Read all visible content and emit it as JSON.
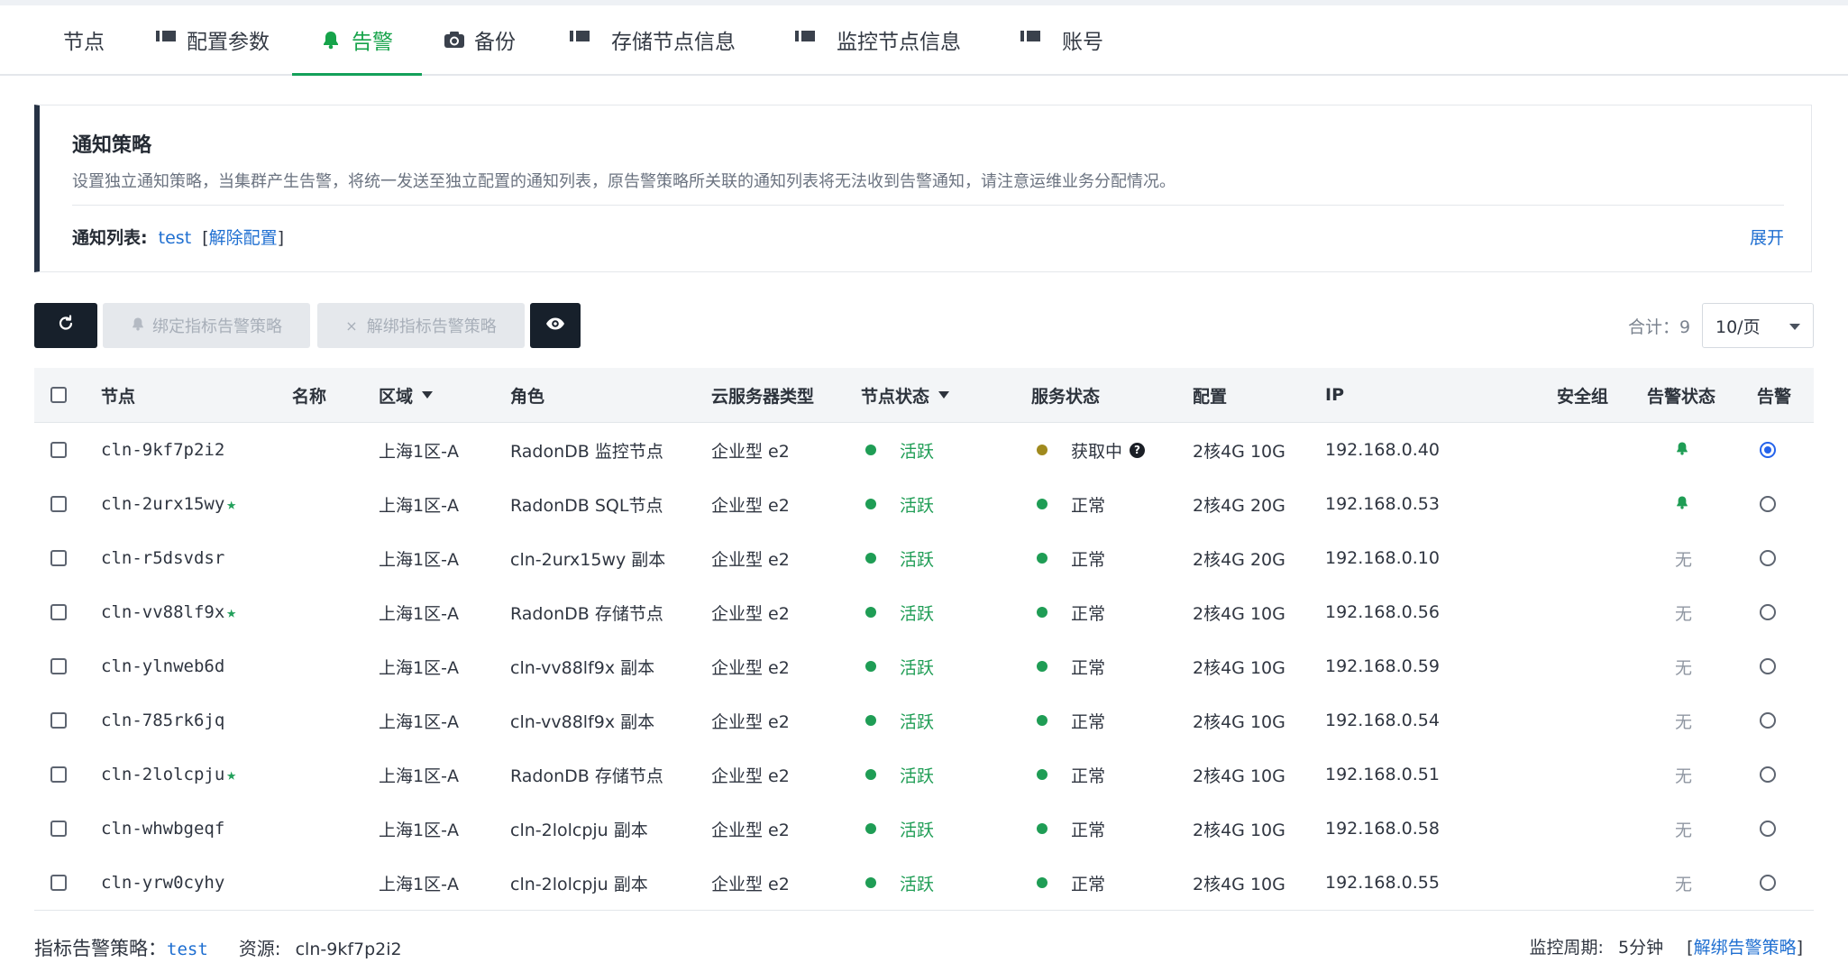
{
  "tabs": [
    {
      "label": "节点",
      "icon": "grid-icon"
    },
    {
      "label": "配置参数",
      "icon": "list-icon"
    },
    {
      "label": "告警",
      "icon": "bell-icon",
      "active": true
    },
    {
      "label": "备份",
      "icon": "camera-icon"
    },
    {
      "label": "存储节点信息",
      "icon": "list-icon"
    },
    {
      "label": "监控节点信息",
      "icon": "list-icon"
    },
    {
      "label": "账号",
      "icon": "list-icon"
    }
  ],
  "notice": {
    "title": "通知策略",
    "description": "设置独立通知策略，当集群产生告警，将统一发送至独立配置的通知列表，原告警策略所关联的通知列表将无法收到告警通知，请注意运维业务分配情况。",
    "list_label": "通知列表:",
    "list_value": "test",
    "unbind_open": "[",
    "unbind_link": "解除配置",
    "unbind_close": "]",
    "expand": "展开"
  },
  "toolbar": {
    "refresh_icon": "refresh-icon",
    "bind_label": "绑定指标告警策略",
    "unbind_label": "解绑指标告警策略",
    "eye_icon": "eye-icon",
    "total": "合计：9",
    "page_size": "10/页"
  },
  "table": {
    "headers": {
      "node": "节点",
      "name": "名称",
      "zone": "区域",
      "role": "角色",
      "server_type": "云服务器类型",
      "node_status": "节点状态",
      "service_status": "服务状态",
      "config": "配置",
      "ip": "IP",
      "security_group": "安全组",
      "alarm_status": "告警状态",
      "alarm": "告警"
    },
    "rows": [
      {
        "node": "cln-9kf7p2i2",
        "star": "",
        "zone": "上海1区-A",
        "role": "RadonDB 监控节点",
        "server_type": "企业型 e2",
        "node_status": "活跃",
        "service_status": "获取中",
        "service_color": "#a08a1e",
        "service_help": "?",
        "config": "2核4G 10G",
        "ip": "192.168.0.40",
        "alarm_status": "bell",
        "alarm_status_text": "",
        "selected": true
      },
      {
        "node": "cln-2urx15wy",
        "star": "★",
        "zone": "上海1区-A",
        "role": "RadonDB SQL节点",
        "server_type": "企业型 e2",
        "node_status": "活跃",
        "service_status": "正常",
        "service_color": "#1f9d55",
        "service_help": "",
        "config": "2核4G 20G",
        "ip": "192.168.0.53",
        "alarm_status": "bell",
        "alarm_status_text": "",
        "selected": false
      },
      {
        "node": "cln-r5dsvdsr",
        "star": "",
        "zone": "上海1区-A",
        "role": "cln-2urx15wy 副本",
        "server_type": "企业型 e2",
        "node_status": "活跃",
        "service_status": "正常",
        "service_color": "#1f9d55",
        "service_help": "",
        "config": "2核4G 20G",
        "ip": "192.168.0.10",
        "alarm_status": "text",
        "alarm_status_text": "无",
        "selected": false
      },
      {
        "node": "cln-vv88lf9x",
        "star": "★",
        "zone": "上海1区-A",
        "role": "RadonDB 存储节点",
        "server_type": "企业型 e2",
        "node_status": "活跃",
        "service_status": "正常",
        "service_color": "#1f9d55",
        "service_help": "",
        "config": "2核4G 10G",
        "ip": "192.168.0.56",
        "alarm_status": "text",
        "alarm_status_text": "无",
        "selected": false
      },
      {
        "node": "cln-ylnweb6d",
        "star": "",
        "zone": "上海1区-A",
        "role": "cln-vv88lf9x 副本",
        "server_type": "企业型 e2",
        "node_status": "活跃",
        "service_status": "正常",
        "service_color": "#1f9d55",
        "service_help": "",
        "config": "2核4G 10G",
        "ip": "192.168.0.59",
        "alarm_status": "text",
        "alarm_status_text": "无",
        "selected": false
      },
      {
        "node": "cln-785rk6jq",
        "star": "",
        "zone": "上海1区-A",
        "role": "cln-vv88lf9x 副本",
        "server_type": "企业型 e2",
        "node_status": "活跃",
        "service_status": "正常",
        "service_color": "#1f9d55",
        "service_help": "",
        "config": "2核4G 10G",
        "ip": "192.168.0.54",
        "alarm_status": "text",
        "alarm_status_text": "无",
        "selected": false
      },
      {
        "node": "cln-2lolcpju",
        "star": "★",
        "zone": "上海1区-A",
        "role": "RadonDB 存储节点",
        "server_type": "企业型 e2",
        "node_status": "活跃",
        "service_status": "正常",
        "service_color": "#1f9d55",
        "service_help": "",
        "config": "2核4G 10G",
        "ip": "192.168.0.51",
        "alarm_status": "text",
        "alarm_status_text": "无",
        "selected": false
      },
      {
        "node": "cln-whwbgeqf",
        "star": "",
        "zone": "上海1区-A",
        "role": "cln-2lolcpju 副本",
        "server_type": "企业型 e2",
        "node_status": "活跃",
        "service_status": "正常",
        "service_color": "#1f9d55",
        "service_help": "",
        "config": "2核4G 10G",
        "ip": "192.168.0.58",
        "alarm_status": "text",
        "alarm_status_text": "无",
        "selected": false
      },
      {
        "node": "cln-yrw0cyhy",
        "star": "",
        "zone": "上海1区-A",
        "role": "cln-2lolcpju 副本",
        "server_type": "企业型 e2",
        "node_status": "活跃",
        "service_status": "正常",
        "service_color": "#1f9d55",
        "service_help": "",
        "config": "2核4G 10G",
        "ip": "192.168.0.55",
        "alarm_status": "text",
        "alarm_status_text": "无",
        "selected": false
      }
    ]
  },
  "footer": {
    "policy_label": "指标告警策略：",
    "policy_value": "test",
    "resource_label": "资源:",
    "resource_value": "cln-9kf7p2i2",
    "period_label": "监控周期:",
    "period_value": "5分钟",
    "unbind_open": "[",
    "unbind_link": "解绑告警策略",
    "unbind_close": "]"
  },
  "colors": {
    "accent": "#16a34a",
    "link": "#1f6fd1",
    "dark_button": "#17202b",
    "active_dot": "#1f9d55",
    "pending_dot": "#a08a1e",
    "radio_selected": "#2563eb"
  }
}
